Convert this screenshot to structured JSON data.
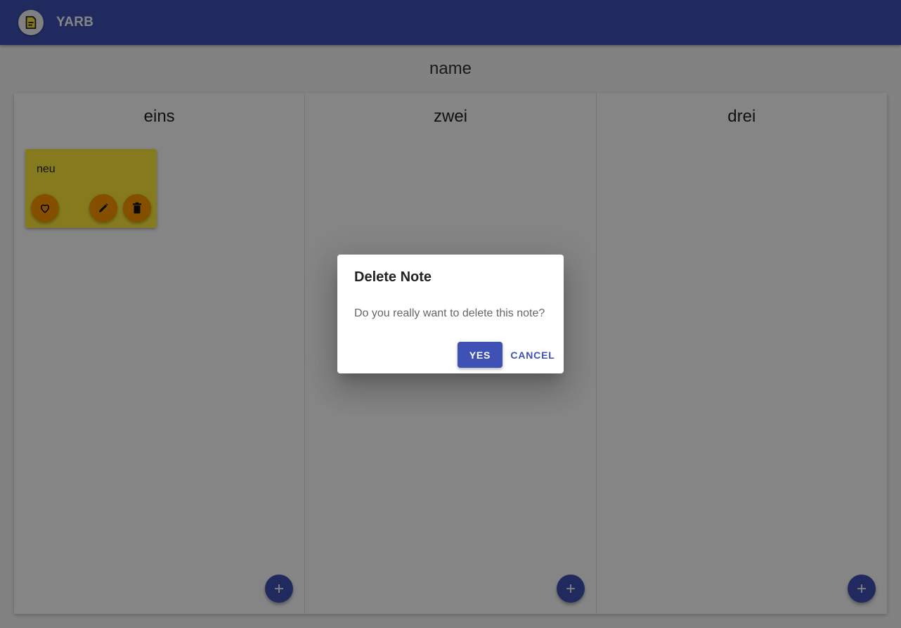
{
  "toolbar": {
    "title": "YARB",
    "logo_icon": "note-icon",
    "color": "#3f51b5"
  },
  "board": {
    "name": "name",
    "columns": [
      {
        "title": "eins",
        "notes": [
          {
            "text": "neu",
            "color": "#ffeb3b"
          }
        ]
      },
      {
        "title": "zwei",
        "notes": []
      },
      {
        "title": "drei",
        "notes": []
      }
    ]
  },
  "note_actions": {
    "favorite_icon": "heart-outline-icon",
    "edit_icon": "pencil-icon",
    "delete_icon": "trash-icon",
    "accent": "#ff9800"
  },
  "add_button_icon": "plus-icon",
  "dialog": {
    "title": "Delete Note",
    "message": "Do you really want to delete this note?",
    "yes_label": "YES",
    "cancel_label": "CANCEL"
  }
}
